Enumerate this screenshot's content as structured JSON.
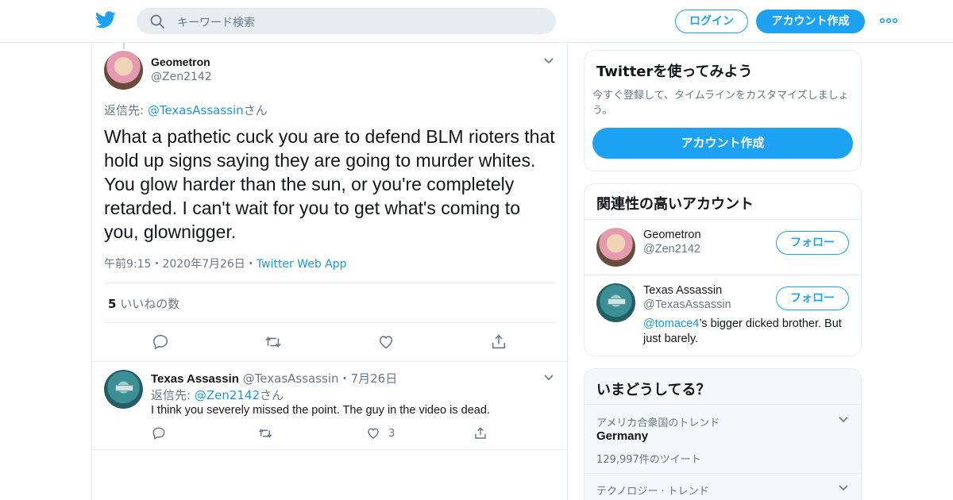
{
  "header": {
    "search_placeholder": "キーワード検索",
    "login_label": "ログイン",
    "signup_label": "アカウント作成",
    "brand_color": "#1da1f2"
  },
  "main_tweet": {
    "author_name": "Geometron",
    "author_handle": "@Zen2142",
    "reply_to_prefix": "返信先: ",
    "reply_to_handle": "@TexasAssassin",
    "reply_to_suffix": "さん",
    "text": "What a pathetic cuck you are to defend BLM rioters that hold up signs saying they are going to murder whites. You glow harder than the sun, or you're completely retarded. I can't wait for you to get what's coming to you, glownigger.",
    "time": "午前9:15",
    "date": "2020年7月26日",
    "separator": "・",
    "client": "Twitter Web App",
    "likes_count": "5",
    "likes_label": "いいねの数"
  },
  "reply_tweet": {
    "author_name": "Texas Assassin",
    "author_handle": "@TexasAssassin",
    "separator": "・",
    "date": "7月26日",
    "reply_to_prefix": "返信先: ",
    "reply_to_handle": "@Zen2142",
    "reply_to_suffix": "さん",
    "text": "I think you severely missed the point. The guy in the video is dead.",
    "likes_count": "3"
  },
  "sidebar": {
    "try_card": {
      "title": "Twitterを使ってみよう",
      "desc_line1": "今すぐ登録して、タイムラインをカスタマイズしましょ",
      "desc_line2": "う。",
      "button": "アカウント作成"
    },
    "relevant_card": {
      "title": "関連性の高いアカウント",
      "accounts": [
        {
          "name": "Geometron",
          "handle": "@Zen2142",
          "follow": "フォロー"
        },
        {
          "name": "Texas Assassin",
          "handle": "@TexasAssassin",
          "follow": "フォロー",
          "bio_mention": "@tomace4",
          "bio_line1_rest": "’s bigger dicked brother. But",
          "bio_line2": "just barely."
        }
      ]
    },
    "trends_card": {
      "title": "いまどうしてる？",
      "trends": [
        {
          "context": "アメリカ合衆国のトレンド",
          "name": "Germany",
          "count": "129,997件のツイート"
        },
        {
          "context": "テクノロジー · トレンド"
        }
      ]
    }
  }
}
